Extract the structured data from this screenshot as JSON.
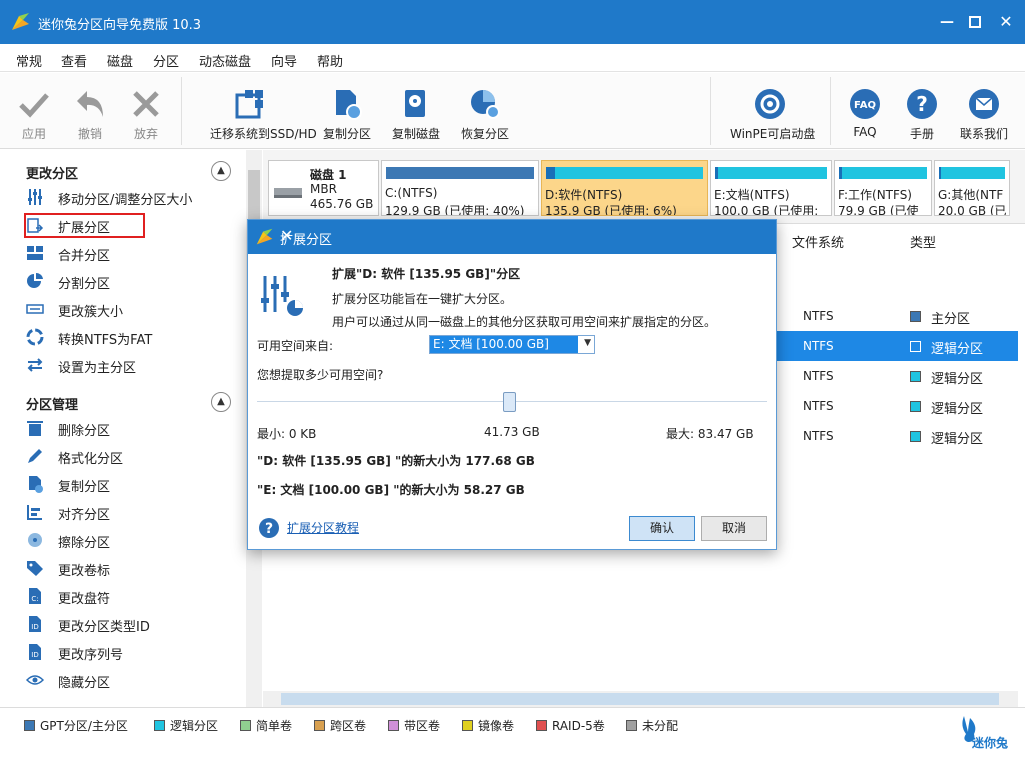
{
  "app": {
    "title": "迷你兔分区向导免费版 10.3"
  },
  "menu": [
    "常规",
    "查看",
    "磁盘",
    "分区",
    "动态磁盘",
    "向导",
    "帮助"
  ],
  "toolbar": {
    "apply": "应用",
    "undo": "撤销",
    "discard": "放弃",
    "migrate": "迁移系统到SSD/HD",
    "copy_partition": "复制分区",
    "copy_disk": "复制磁盘",
    "recover_partition": "恢复分区",
    "winpe": "WinPE可启动盘",
    "faq": "FAQ",
    "manual": "手册",
    "contact": "联系我们"
  },
  "sidebar": {
    "section1": "更改分区",
    "section1_items": [
      "移动分区/调整分区大小",
      "扩展分区",
      "合并分区",
      "分割分区",
      "更改簇大小",
      "转换NTFS为FAT",
      "设置为主分区"
    ],
    "section2": "分区管理",
    "section2_items": [
      "删除分区",
      "格式化分区",
      "复制分区",
      "对齐分区",
      "擦除分区",
      "更改卷标",
      "更改盘符",
      "更改分区类型ID",
      "更改序列号",
      "隐藏分区"
    ]
  },
  "disk": {
    "name": "磁盘 1",
    "style": "MBR",
    "size": "465.76 GB"
  },
  "partitions": [
    {
      "line1": "C:(NTFS)",
      "line2": "129.9 GB (已使用: 40%)",
      "usage": 40,
      "color": "#3c78b4"
    },
    {
      "line1": "D:软件(NTFS)",
      "line2": "135.9 GB (已使用: 6%)",
      "usage": 6,
      "color": "#20c4e0"
    },
    {
      "line1": "E:文档(NTFS)",
      "line2": "100.0 GB (已使用:",
      "usage": 3,
      "color": "#20c4e0"
    },
    {
      "line1": "F:工作(NTFS)",
      "line2": "79.9 GB (已使",
      "usage": 3,
      "color": "#20c4e0"
    },
    {
      "line1": "G:其他(NTF",
      "line2": "20.0 GB (已",
      "usage": 3,
      "color": "#20c4e0"
    }
  ],
  "table": {
    "headers": [
      "文件系统",
      "类型"
    ],
    "rows": [
      {
        "fs": "NTFS",
        "type": "主分区",
        "color": "#3c78b4"
      },
      {
        "fs": "NTFS",
        "type": "逻辑分区",
        "color": "#1e88e5"
      },
      {
        "fs": "NTFS",
        "type": "逻辑分区",
        "color": "#20c4e0"
      },
      {
        "fs": "NTFS",
        "type": "逻辑分区",
        "color": "#20c4e0"
      },
      {
        "fs": "NTFS",
        "type": "逻辑分区",
        "color": "#20c4e0"
      }
    ]
  },
  "legend": [
    {
      "label": "GPT分区/主分区",
      "color": "#3c78b4"
    },
    {
      "label": "逻辑分区",
      "color": "#20c4e0"
    },
    {
      "label": "简单卷",
      "color": "#90d090"
    },
    {
      "label": "跨区卷",
      "color": "#d8a050"
    },
    {
      "label": "带区卷",
      "color": "#d090d8"
    },
    {
      "label": "镜像卷",
      "color": "#e0d020"
    },
    {
      "label": "RAID-5卷",
      "color": "#e05050"
    },
    {
      "label": "未分配",
      "color": "#a0a0a0"
    }
  ],
  "brand": "迷你兔",
  "dialog": {
    "title": "扩展分区",
    "heading": "扩展\"D: 软件 [135.95 GB]\"分区",
    "desc1": "扩展分区功能旨在一键扩大分区。",
    "desc2": "用户可以通过从同一磁盘上的其他分区获取可用空间来扩展指定的分区。",
    "source_label": "可用空间来自:",
    "source_value": "E: 文档 [100.00 GB]",
    "question": "您想提取多少可用空间?",
    "slider_fraction": 0.5,
    "min": "最小: 0 KB",
    "current": "41.73 GB",
    "max": "最大:  83.47 GB",
    "result_d": "\"D: 软件 [135.95 GB] \"的新大小为 177.68 GB",
    "result_e": "\"E: 文档 [100.00 GB] \"的新大小为 58.27 GB",
    "help": "扩展分区教程",
    "ok": "确认",
    "cancel": "取消"
  }
}
